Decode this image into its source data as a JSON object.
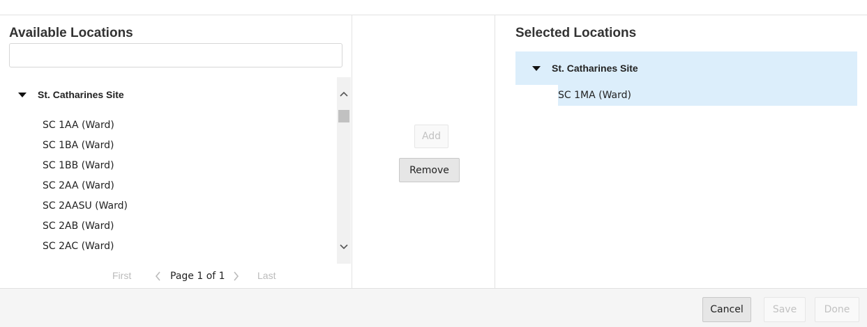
{
  "available": {
    "title": "Available Locations",
    "search_placeholder": "",
    "site_label": "St. Catharines Site",
    "items": [
      "SC 1AA (Ward)",
      "SC 1BA (Ward)",
      "SC 1BB (Ward)",
      "SC 2AA (Ward)",
      "SC 2AASU (Ward)",
      "SC 2AB (Ward)",
      "SC 2AC (Ward)"
    ],
    "pager": {
      "first": "First",
      "page_text": "Page 1 of 1",
      "last": "Last"
    }
  },
  "actions": {
    "add": "Add",
    "remove": "Remove"
  },
  "selected": {
    "title": "Selected Locations",
    "site_label": "St. Catharines Site",
    "items": [
      "SC 1MA (Ward)"
    ]
  },
  "footer": {
    "cancel": "Cancel",
    "save": "Save",
    "done": "Done"
  },
  "colors": {
    "selected_highlight": "#dceefb",
    "footer_bg": "#f5f5f5"
  },
  "icons": {
    "expand": "caret-down-icon",
    "scroll_up": "chevron-up-icon",
    "scroll_down": "chevron-down-icon",
    "prev": "chevron-left-icon",
    "next": "chevron-right-icon"
  }
}
